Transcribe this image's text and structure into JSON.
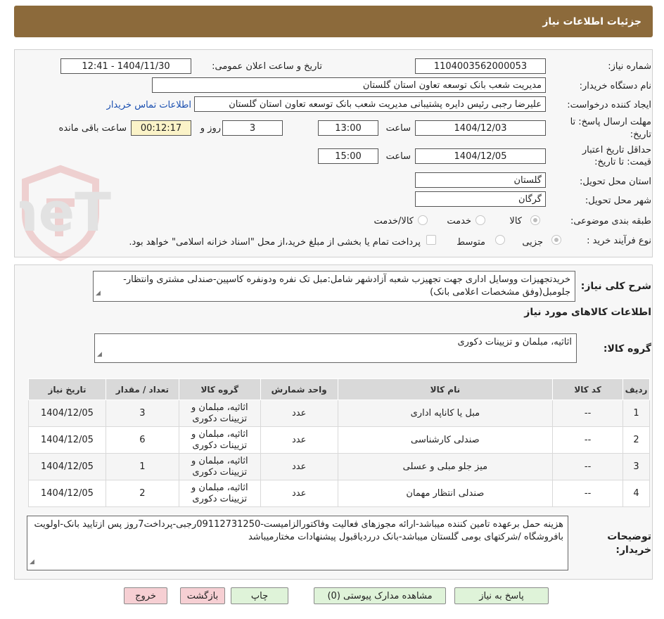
{
  "header": {
    "title": "جزئیات اطلاعات نیاز"
  },
  "form": {
    "need_number": {
      "label": "شماره نیاز:",
      "value": "1104003562000053"
    },
    "announce": {
      "label": "تاریخ و ساعت اعلان عمومی:",
      "value": "1404/11/30 - 12:41"
    },
    "buyer_org": {
      "label": "نام دستگاه خریدار:",
      "value": "مدیریت شعب بانک توسعه تعاون استان گلستان"
    },
    "requester": {
      "label": "ایجاد کننده درخواست:",
      "value": "علیرضا رجبی رئیس دایره پشتیبانی مدیریت شعب بانک توسعه تعاون استان گلستان",
      "contact_link": "اطلاعات تماس خریدار"
    },
    "reply_deadline": {
      "label_line1": "مهلت ارسال پاسخ: تا",
      "label_line2": "تاریخ:",
      "date": "1404/12/03",
      "time_label": "ساعت",
      "time": "13:00",
      "days": "3",
      "days_label": "روز و",
      "remaining": "00:12:17",
      "remaining_label": "ساعت باقی مانده"
    },
    "price_validity": {
      "label_line1": "حداقل تاریخ اعتبار",
      "label_line2": "قیمت: تا تاریخ:",
      "date": "1404/12/05",
      "time_label": "ساعت",
      "time": "15:00"
    },
    "province": {
      "label": "استان محل تحویل:",
      "value": "گلستان"
    },
    "city": {
      "label": "شهر محل تحویل:",
      "value": "گرگان"
    },
    "category": {
      "label": "طبقه بندی موضوعی:",
      "options": [
        "کالا",
        "خدمت",
        "کالا/خدمت"
      ],
      "selected": "کالا"
    },
    "process": {
      "label": "نوع فرآیند خرید :",
      "options": [
        "جزیی",
        "متوسط"
      ],
      "selected": "جزیی",
      "treasury_note": "پرداخت تمام یا بخشی از مبلغ خرید،از محل \"اسناد خزانه اسلامی\" خواهد بود."
    }
  },
  "description": {
    "label": "شرح کلی نیاز:",
    "text": "خریدتجهیزات ووسایل اداری جهت تجهیزب شعبه آزادشهر شامل:مبل تک نفره ودونفره کاسپین-صندلی مشتری وانتظار-جلومبل(وفق مشخصات اعلامی بانک)"
  },
  "goods_section_title": "اطلاعات کالاهای مورد نیاز",
  "goods_group": {
    "label": "گروه کالا:",
    "value": "اثاثیه، مبلمان و تزیینات دکوری"
  },
  "table": {
    "headers": [
      "ردیف",
      "کد کالا",
      "نام کالا",
      "واحد شمارش",
      "گروه کالا",
      "تعداد / مقدار",
      "تاریخ نیاز"
    ],
    "rows": [
      {
        "idx": "1",
        "code": "--",
        "name": "مبل یا کاناپه اداری",
        "unit": "عدد",
        "group_l1": "اثاثیه، مبلمان و",
        "group_l2": "تزیینات دکوری",
        "qty": "3",
        "date": "1404/12/05"
      },
      {
        "idx": "2",
        "code": "--",
        "name": "صندلی کارشناسی",
        "unit": "عدد",
        "group_l1": "اثاثیه، مبلمان و",
        "group_l2": "تزیینات دکوری",
        "qty": "6",
        "date": "1404/12/05"
      },
      {
        "idx": "3",
        "code": "--",
        "name": "میز جلو مبلی و عسلی",
        "unit": "عدد",
        "group_l1": "اثاثیه، مبلمان و",
        "group_l2": "تزیینات دکوری",
        "qty": "1",
        "date": "1404/12/05"
      },
      {
        "idx": "4",
        "code": "--",
        "name": "صندلی انتظار مهمان",
        "unit": "عدد",
        "group_l1": "اثاثیه، مبلمان و",
        "group_l2": "تزیینات دکوری",
        "qty": "2",
        "date": "1404/12/05"
      }
    ]
  },
  "buyer_notes": {
    "label_line1": "توضیحات",
    "label_line2": "خریدار:",
    "text": "هزینه حمل برعهده تامین کننده میباشد-ارائه مجوزهای فعالیت وفاکتورالزامیست-09112731250رجبی-پرداخت7روز پس ازتایید بانک-اولویت بافروشگاه /شرکتهای بومی گلستان میباشد-بانک درردیاقبول پیشنهادات مختارمیباشد"
  },
  "buttons": {
    "reply": "پاسخ به نیاز",
    "attachments": "مشاهده مدارک پیوستی (0)",
    "print": "چاپ",
    "back": "بازگشت",
    "exit": "خروج"
  },
  "watermark": {
    "text": "AriaTender.neT"
  },
  "colors": {
    "header_bg": "#8c6a3b",
    "link": "#1a4fb0",
    "timer_bg": "#fbf3c8",
    "button_green": "#dff3d9",
    "button_red": "#f6cfd3",
    "watermark": "#c62828"
  }
}
